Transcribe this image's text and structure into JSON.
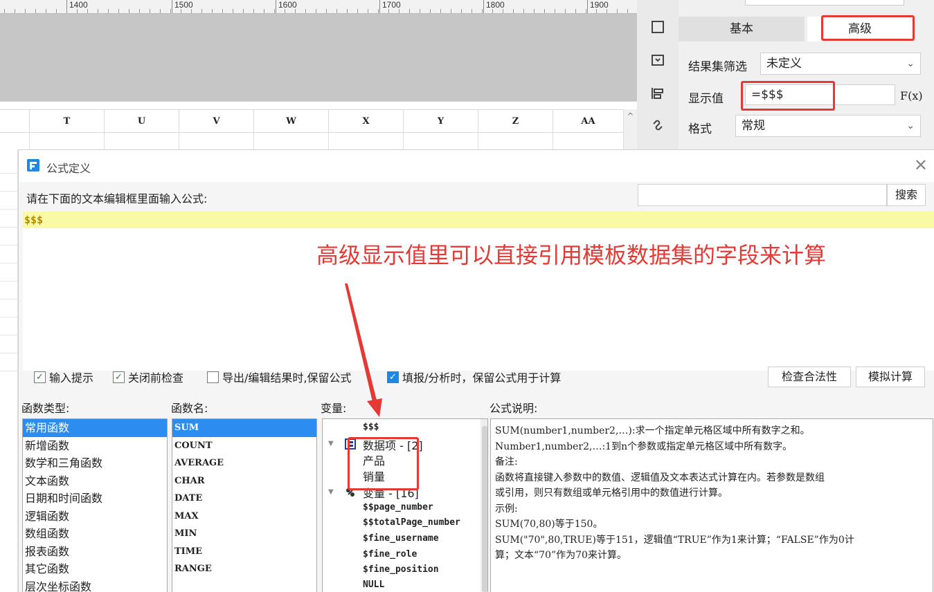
{
  "ruler": {
    "labels": [
      "1400",
      "1500",
      "1600",
      "1700",
      "1800",
      "1900"
    ]
  },
  "sheet": {
    "columns": [
      "T",
      "U",
      "V",
      "W",
      "X",
      "Y",
      "Z",
      "AA"
    ],
    "scroll_up_glyph": "^"
  },
  "right_panel": {
    "tabs": {
      "basic": "基本",
      "advanced": "高级"
    },
    "result_filter": {
      "label": "结果集筛选",
      "value": "未定义"
    },
    "display_value": {
      "label": "显示值",
      "value": "=$$$"
    },
    "format": {
      "label": "格式",
      "value": "常规"
    },
    "fx_label": "F(x)",
    "icons": [
      "border-icon",
      "widget-icon",
      "align-icon",
      "link-icon"
    ],
    "accent_color": "#e53935"
  },
  "dialog": {
    "title": "公式定义",
    "prompt": "请在下面的文本编辑框里面输入公式:",
    "search_button": "搜索",
    "search_value": "",
    "formula": "$$$",
    "annotation": "高级显示值里可以直接引用模板数据集的字段来计算",
    "options": [
      {
        "label": "输入提示",
        "checked": true
      },
      {
        "label": "关闭前检查",
        "checked": true
      },
      {
        "label": "导出/编辑结果时,保留公式",
        "checked": false
      },
      {
        "label": "填报/分析时，保留公式用于计算",
        "checked": true
      }
    ],
    "check_validity_button": "检查合法性",
    "simulate_button": "模拟计算",
    "labels": {
      "function_type": "函数类型:",
      "function_name": "函数名:",
      "variable": "变量:",
      "description": "公式说明:"
    },
    "function_types": [
      "常用函数",
      "新增函数",
      "数学和三角函数",
      "文本函数",
      "日期和时间函数",
      "逻辑函数",
      "数组函数",
      "报表函数",
      "其它函数",
      "层次坐标函数"
    ],
    "function_names": [
      "SUM",
      "COUNT",
      "AVERAGE",
      "CHAR",
      "DATE",
      "MAX",
      "MIN",
      "TIME",
      "RANGE"
    ],
    "variables": {
      "root": "$$$",
      "data_group": "数据项 - [2]",
      "data_items": [
        "产品",
        "销量"
      ],
      "var_group": "变量 - [16]",
      "var_items": [
        "$$page_number",
        "$$totalPage_number",
        "$fine_username",
        "$fine_role",
        "$fine_position",
        "NULL"
      ]
    },
    "description_lines": [
      "SUM(number1,number2,…):求一个指定单元格区域中所有数字之和。",
      "Number1,number2,…:1到n个参数或指定单元格区域中所有数字。",
      "备注:",
      "函数将直接键入参数中的数值、逻辑值及文本表达式计算在内。若参数是数组",
      "或引用，则只有数组或单元格引用中的数值进行计算。",
      "示例:",
      "SUM(70,80)等于150。",
      "SUM(\"70\",80,TRUE)等于151，逻辑值“TRUE”作为1来计算；“FALSE”作为0计",
      "算；文本“70”作为70来计算。"
    ]
  }
}
